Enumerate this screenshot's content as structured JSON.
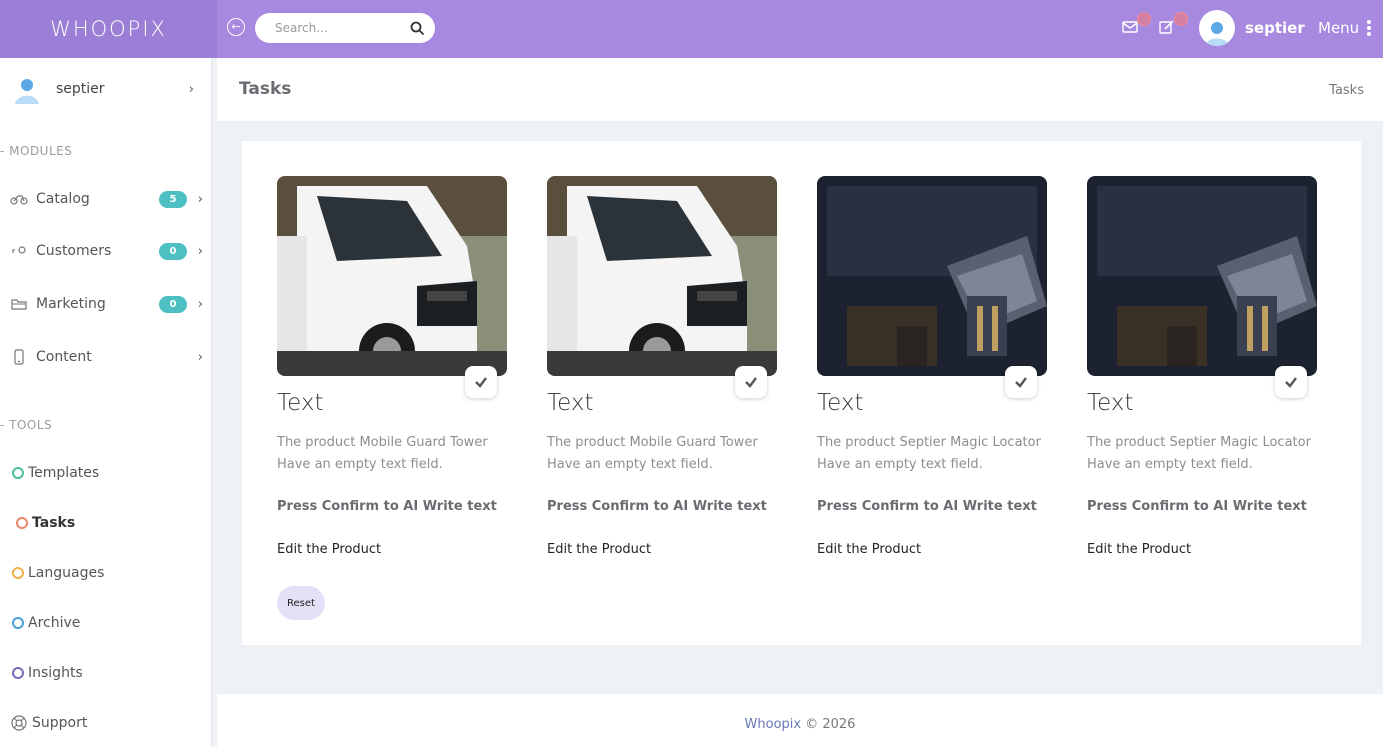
{
  "app": {
    "logo": "WHOOPIX"
  },
  "topbar": {
    "search_placeholder": "Search...",
    "user_name": "septier",
    "menu_label": "Menu",
    "accent": "#a78ae0"
  },
  "sidebar": {
    "user_name": "septier",
    "modules_heading": "- MODULES",
    "modules": [
      {
        "label": "Catalog",
        "badge": "5",
        "icon": "bike-icon"
      },
      {
        "label": "Customers",
        "badge": "0",
        "icon": "key-icon"
      },
      {
        "label": "Marketing",
        "badge": "0",
        "icon": "folder-icon"
      },
      {
        "label": "Content",
        "icon": "phone-icon"
      }
    ],
    "tools_heading": "- TOOLS",
    "tools": [
      {
        "label": "Templates",
        "color": "#4bbf9a"
      },
      {
        "label": "Tasks",
        "color": "#e8876a"
      },
      {
        "label": "Languages",
        "color": "#f0b04a"
      },
      {
        "label": "Archive",
        "color": "#4aa0d8"
      },
      {
        "label": "Insights",
        "color": "#7b6bb8"
      },
      {
        "label": "Support",
        "icon": "lifebuoy-icon"
      }
    ]
  },
  "page": {
    "title": "Tasks",
    "breadcrumb": "Tasks"
  },
  "products": [
    {
      "image": "truck-image",
      "title": "Text",
      "description": "The product Mobile Guard Tower Have an empty text field.",
      "confirm": "Press Confirm to AI Write text",
      "edit": "Edit the Product"
    },
    {
      "image": "truck-image",
      "title": "Text",
      "description": "The product Mobile Guard Tower Have an empty text field.",
      "confirm": "Press Confirm to AI Write text",
      "edit": "Edit the Product"
    },
    {
      "image": "device-case-image",
      "title": "Text",
      "description": "The product Septier Magic Locator Have an empty text field.",
      "confirm": "Press Confirm to AI Write text",
      "edit": "Edit the Product"
    },
    {
      "image": "device-case-image",
      "title": "Text",
      "description": "The product Septier Magic Locator Have an empty text field.",
      "confirm": "Press Confirm to AI Write text",
      "edit": "Edit the Product"
    }
  ],
  "actions": {
    "reset_label": "Reset"
  },
  "footer": {
    "brand": "Whoopix",
    "copyright": " © 2026"
  }
}
